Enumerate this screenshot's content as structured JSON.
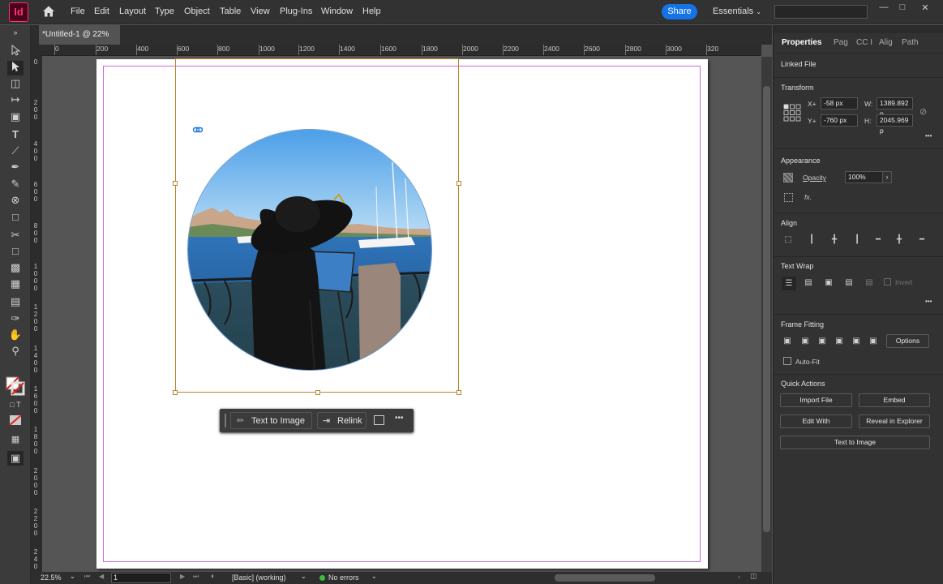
{
  "app": {
    "logo": "Id"
  },
  "menubar": {
    "items": [
      "File",
      "Edit",
      "Layout",
      "Type",
      "Object",
      "Table",
      "View",
      "Plug-Ins",
      "Window",
      "Help"
    ],
    "share_label": "Share",
    "workspace_label": "Essentials"
  },
  "document": {
    "tab_title": "*Untitled-1 @ 22%"
  },
  "ruler": {
    "h_ticks": [
      "200",
      "0",
      "200",
      "400",
      "600",
      "800",
      "1000",
      "1200",
      "1400",
      "1600",
      "1800",
      "2000",
      "2200",
      "2400",
      "2600",
      "2800",
      "3000",
      "320"
    ],
    "v_ticks": [
      "0",
      "2 0 0",
      "4 0 0",
      "6 0 0",
      "8 0 0",
      "1 0 0 0",
      "1 2 0 0",
      "1 4 0 0",
      "1 6 0 0",
      "1 8 0 0",
      "2 0 0 0",
      "2 2 0 0",
      "2 4 0"
    ]
  },
  "context_bar": {
    "text_to_image": "Text to Image",
    "relink": "Relink",
    "more": "•••"
  },
  "statusbar": {
    "zoom": "22.5%",
    "page": "1",
    "style": "[Basic] (working)",
    "errors": "No errors",
    "errors_color": "#3dbd3d"
  },
  "panel": {
    "tabs": [
      "Properties",
      "Pag",
      "CC I",
      "Alig",
      "Path"
    ],
    "linked_file": "Linked File",
    "transform": {
      "title": "Transform",
      "x_label": "X+",
      "x_value": "-58 px",
      "y_label": "Y+",
      "y_value": "-760 px",
      "w_label": "W:",
      "w_value": "1389.892 p",
      "h_label": "H:",
      "h_value": "2045.969 p"
    },
    "appearance": {
      "title": "Appearance",
      "opacity_label": "Opacity",
      "opacity_value": "100%",
      "fx": "fx."
    },
    "align": {
      "title": "Align"
    },
    "text_wrap": {
      "title": "Text Wrap",
      "invert": "Invert"
    },
    "frame_fitting": {
      "title": "Frame Fitting",
      "options": "Options",
      "auto_fit": "Auto-Fit"
    },
    "quick_actions": {
      "title": "Quick Actions",
      "import_file": "Import File",
      "embed": "Embed",
      "edit_with": "Edit With",
      "reveal": "Reveal in Explorer",
      "text_to_image": "Text to Image"
    },
    "more": "•••"
  },
  "colors": {
    "accent": "#1473e6",
    "frame": "#b8862b",
    "margin": "#cc66dd",
    "brand": "#ff3366"
  }
}
